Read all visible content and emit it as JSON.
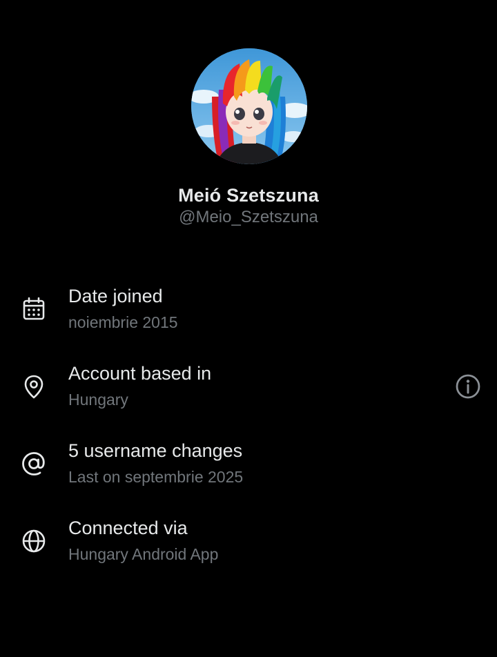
{
  "profile": {
    "display_name": "Meió Szetszuna",
    "handle": "@Meio_Szetszuna",
    "avatar_description_icon": "anime-avatar-rainbow-hair"
  },
  "about": [
    {
      "icon": "calendar-icon",
      "title": "Date joined",
      "value": "noiembrie 2015"
    },
    {
      "icon": "location-pin-icon",
      "title": "Account based in",
      "value": "Hungary",
      "has_info_button": true
    },
    {
      "icon": "at-sign-icon",
      "title": "5 username changes",
      "value": "Last on septembrie 2025"
    },
    {
      "icon": "globe-icon",
      "title": "Connected via",
      "value": "Hungary Android App"
    }
  ],
  "colors": {
    "background": "#000000",
    "primary_text": "#e7e9ea",
    "secondary_text": "#71767b"
  }
}
